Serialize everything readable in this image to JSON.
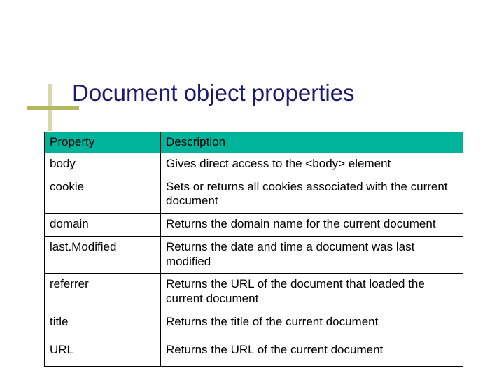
{
  "title": "Document object properties",
  "columns": {
    "c1": "Property",
    "c2": "Description"
  },
  "rows": [
    {
      "prop": "body",
      "desc": "Gives direct access to the <body> element"
    },
    {
      "prop": "cookie",
      "desc": "Sets or returns all cookies associated with the current document"
    },
    {
      "prop": "domain",
      "desc": "Returns the domain name for the current document"
    },
    {
      "prop": "last.Modified",
      "desc": "Returns the date and time a document was last modified"
    },
    {
      "prop": "referrer",
      "desc": "Returns the URL of the document that loaded the current document"
    },
    {
      "prop": "title",
      "desc": "Returns the title of the current document"
    },
    {
      "prop": "URL",
      "desc": "Returns the URL of the current document"
    }
  ],
  "colors": {
    "accent": "#00b39b",
    "titleColor": "#1a1a6e"
  }
}
